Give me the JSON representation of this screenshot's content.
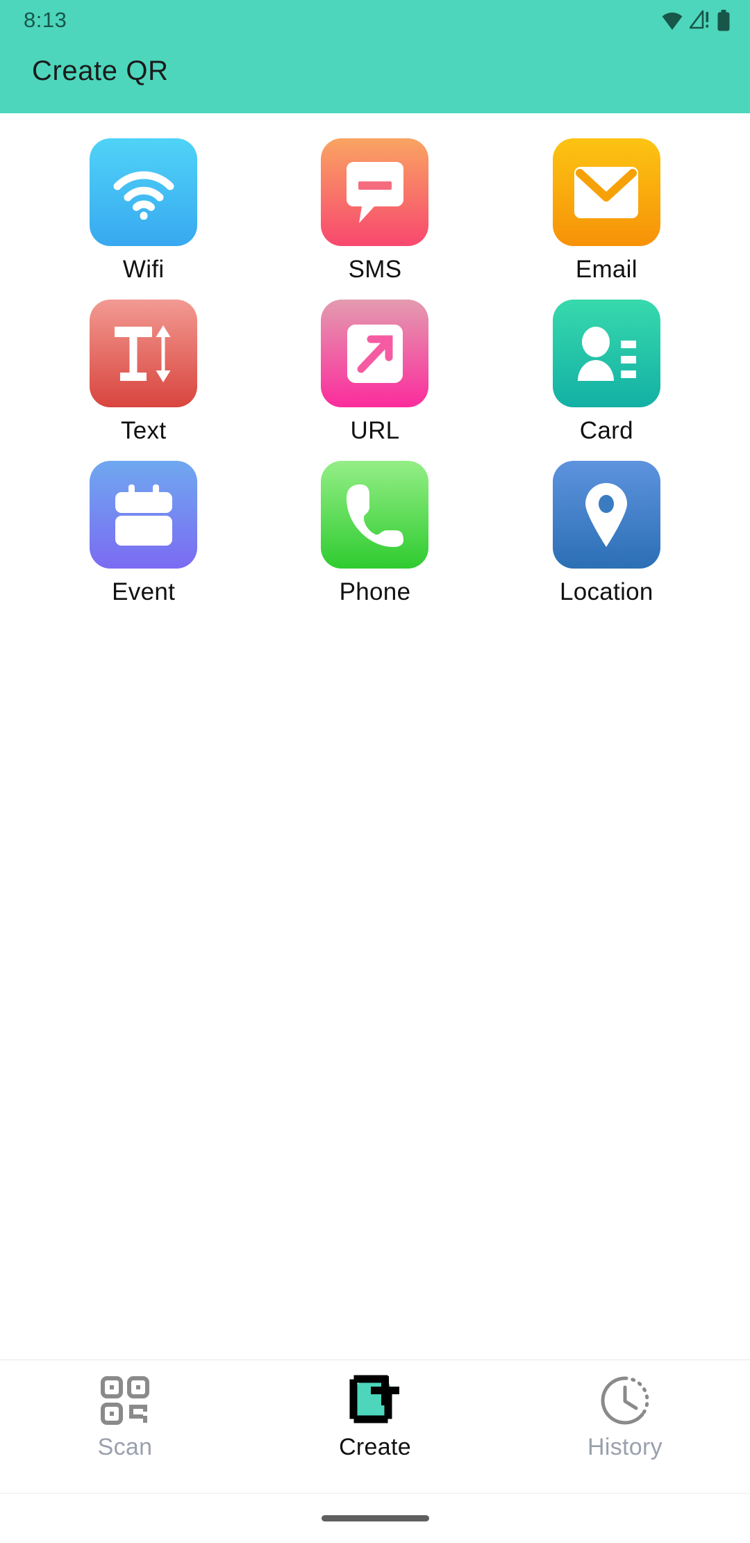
{
  "status_bar": {
    "time": "8:13",
    "icons": [
      "wifi-icon",
      "cellular-no-service-icon",
      "battery-icon"
    ],
    "icon_color": "#18564a"
  },
  "header": {
    "title": "Create QR",
    "background_color": "#4DD6BC",
    "title_color": "#1b1b1b"
  },
  "grid": {
    "items": [
      {
        "label": "Wifi",
        "icon": "wifi-icon",
        "gradient_from": "#4FD3F7",
        "gradient_to": "#38A8F0"
      },
      {
        "label": "SMS",
        "icon": "message-icon",
        "gradient_from": "#F9A462",
        "gradient_to": "#F8486F"
      },
      {
        "label": "Email",
        "icon": "envelope-icon",
        "gradient_from": "#FCC412",
        "gradient_to": "#F79208"
      },
      {
        "label": "Text",
        "icon": "text-size-icon",
        "gradient_from": "#F29A92",
        "gradient_to": "#D8453E"
      },
      {
        "label": "URL",
        "icon": "link-arrow-icon",
        "gradient_from": "#E39BAF",
        "gradient_to": "#FB2C9C"
      },
      {
        "label": "Card",
        "icon": "contact-card-icon",
        "gradient_from": "#37D9AC",
        "gradient_to": "#13B0A5"
      },
      {
        "label": "Event",
        "icon": "calendar-icon",
        "gradient_from": "#6FA8F0",
        "gradient_to": "#7B6BF2"
      },
      {
        "label": "Phone",
        "icon": "phone-icon",
        "gradient_from": "#94EE86",
        "gradient_to": "#2FCB30"
      },
      {
        "label": "Location",
        "icon": "map-pin-icon",
        "gradient_from": "#5E93DE",
        "gradient_to": "#2B6FB5"
      }
    ]
  },
  "bottom_nav": {
    "items": [
      {
        "label": "Scan",
        "icon": "qr-code-icon",
        "active": false,
        "color": "#9aa0ad"
      },
      {
        "label": "Create",
        "icon": "create-qr-icon",
        "active": true,
        "color": "#111111"
      },
      {
        "label": "History",
        "icon": "clock-history-icon",
        "active": false,
        "color": "#9aa0ad"
      }
    ],
    "accent_color": "#4DD6BC"
  }
}
